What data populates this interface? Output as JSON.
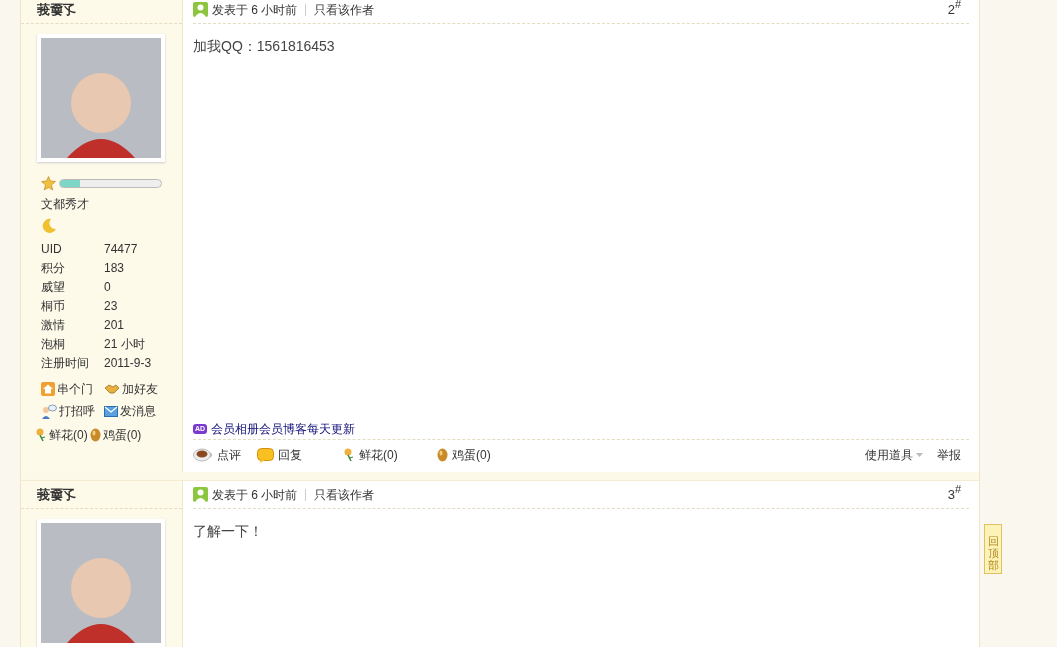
{
  "posts": [
    {
      "author": "莪嫑孓",
      "level": 0.2,
      "rank_title": "文都秀才",
      "stats": [
        {
          "label": "UID",
          "value": "74477"
        },
        {
          "label": "积分",
          "value": "183"
        },
        {
          "label": "威望",
          "value": "0"
        },
        {
          "label": "桐币",
          "value": "23"
        },
        {
          "label": "激情",
          "value": "201"
        },
        {
          "label": "泡桐",
          "value": "21 小时"
        },
        {
          "label": "注册时间",
          "value": "2011-9-3"
        }
      ],
      "profile_actions": [
        {
          "kind": "home",
          "label": "串个门"
        },
        {
          "kind": "friend",
          "label": "加好友"
        },
        {
          "kind": "greet",
          "label": "打招呼"
        },
        {
          "kind": "message",
          "label": "发消息"
        }
      ],
      "gifts": [
        {
          "kind": "flower",
          "label": "鲜花(0)"
        },
        {
          "kind": "egg",
          "label": "鸡蛋(0)"
        }
      ],
      "posted": "发表于 6 小时前",
      "only_author": "只看该作者",
      "floor": "2",
      "floor_mark": "#",
      "content": "加我QQ：1561816453",
      "ad": {
        "badge": "AD",
        "text": "会员相册会员博客每天更新"
      },
      "actions": [
        {
          "kind": "comment",
          "label": "点评"
        },
        {
          "kind": "reply",
          "label": "回复"
        },
        {
          "kind": "flower",
          "label": "鲜花(0)"
        },
        {
          "kind": "egg",
          "label": "鸡蛋(0)"
        }
      ],
      "tools": "使用道具",
      "report": "举报"
    },
    {
      "author": "莪嫑孓",
      "posted": "发表于 6 小时前",
      "only_author": "只看该作者",
      "floor": "3",
      "floor_mark": "#",
      "content": "了解一下！"
    }
  ],
  "back_to_top": "回顶部"
}
